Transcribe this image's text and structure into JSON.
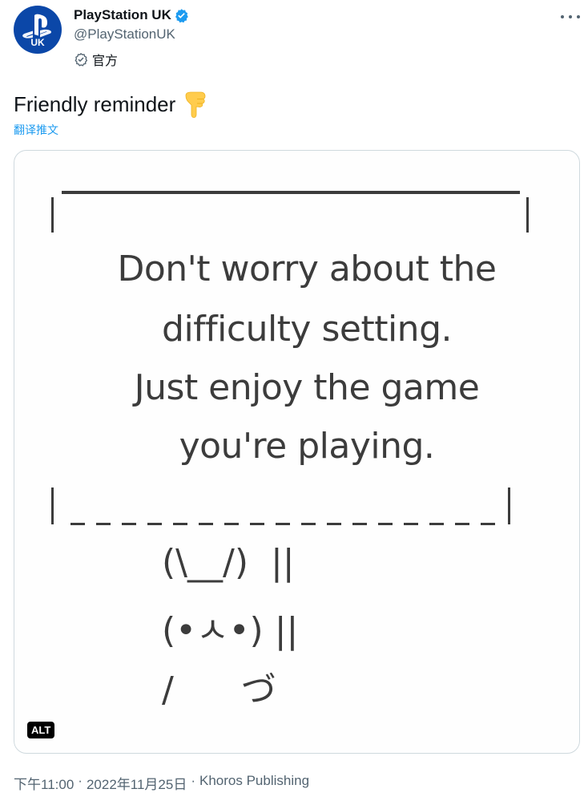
{
  "author": {
    "display_name": "PlayStation UK",
    "handle": "@PlayStationUK",
    "avatar_text": "UK",
    "affiliation_label": "官方"
  },
  "tweet": {
    "text": "Friendly reminder",
    "emoji_icon": "backhand-index-pointing-down",
    "translate_label": "翻译推文"
  },
  "media": {
    "message_lines": [
      "Don't worry about the",
      "difficulty setting.",
      "Just enjoy the game",
      "you're playing."
    ],
    "art_lines": [
      "(\\__/)  ||",
      "(•ㅅ•) ||",
      "/      づ"
    ],
    "alt_label": "ALT"
  },
  "meta": {
    "time": "下午11:00",
    "date": "2022年11月25日",
    "source": "Khoros Publishing",
    "separator": "·"
  },
  "colors": {
    "brand_blue": "#0b47a8",
    "verified_blue": "#1d9bf0",
    "text": "#0f1419",
    "secondary": "#536471"
  }
}
